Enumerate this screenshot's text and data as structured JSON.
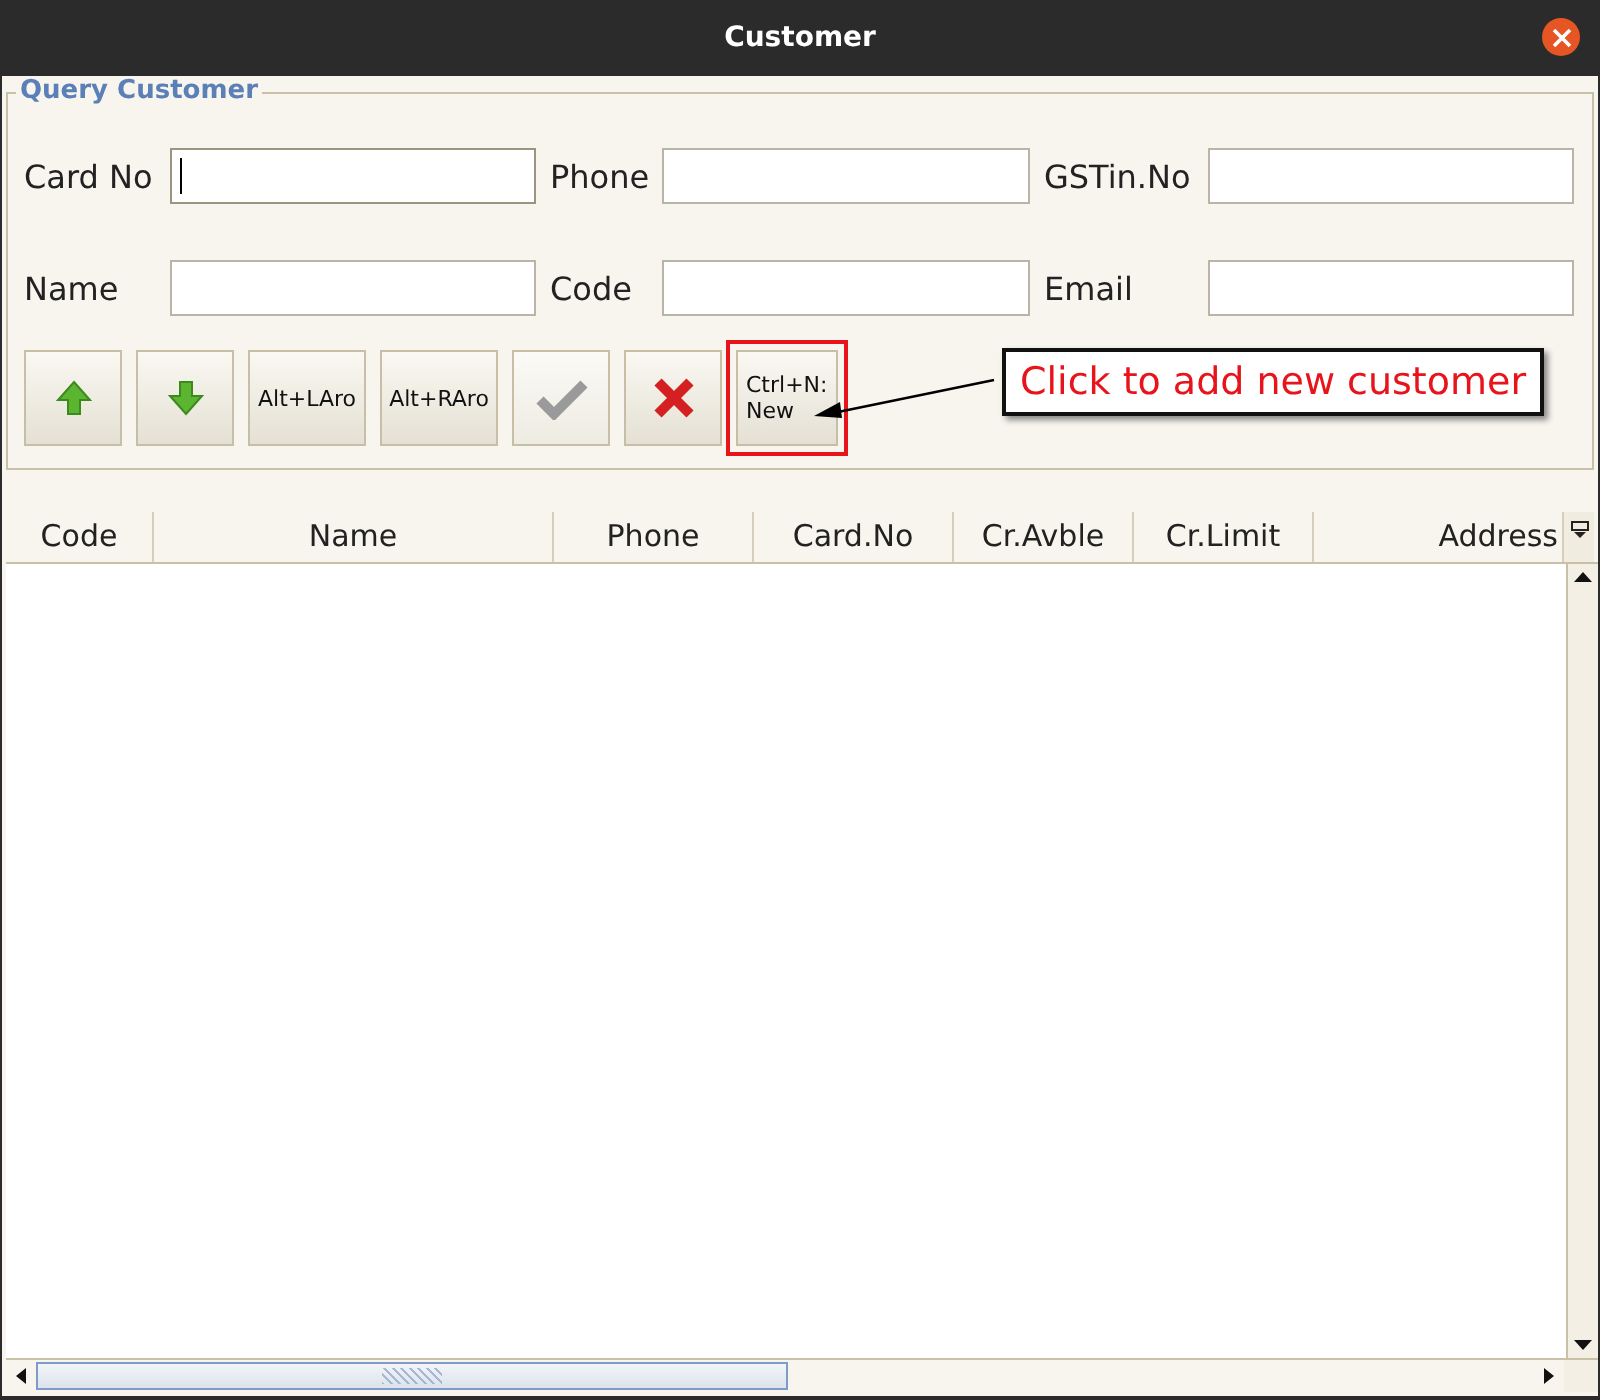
{
  "window": {
    "title": "Customer"
  },
  "query_group": {
    "title": "Query Customer",
    "fields": [
      {
        "label": "Card No",
        "focused": true
      },
      {
        "label": "Phone",
        "focused": false
      },
      {
        "label": "GSTin.No",
        "focused": false
      },
      {
        "label": "Name",
        "focused": false
      },
      {
        "label": "Code",
        "focused": false
      },
      {
        "label": "Email",
        "focused": false
      }
    ],
    "buttons": [
      {
        "kind": "up",
        "disabled": false,
        "highlighted": false
      },
      {
        "kind": "down",
        "disabled": false,
        "highlighted": false
      },
      {
        "kind": "text",
        "label": "Alt+LAro",
        "disabled": false,
        "highlighted": false
      },
      {
        "kind": "text",
        "label": "Alt+RAro",
        "disabled": false,
        "highlighted": false
      },
      {
        "kind": "check",
        "disabled": true,
        "highlighted": false
      },
      {
        "kind": "cross",
        "disabled": false,
        "highlighted": false
      },
      {
        "kind": "text",
        "label": "Ctrl+N:\nNew",
        "disabled": false,
        "highlighted": true
      }
    ]
  },
  "annotation": {
    "text": "Click to add new customer"
  },
  "table": {
    "columns": [
      "Code",
      "Name",
      "Phone",
      "Card.No",
      "Cr.Avble",
      "Cr.Limit",
      "Address"
    ]
  }
}
